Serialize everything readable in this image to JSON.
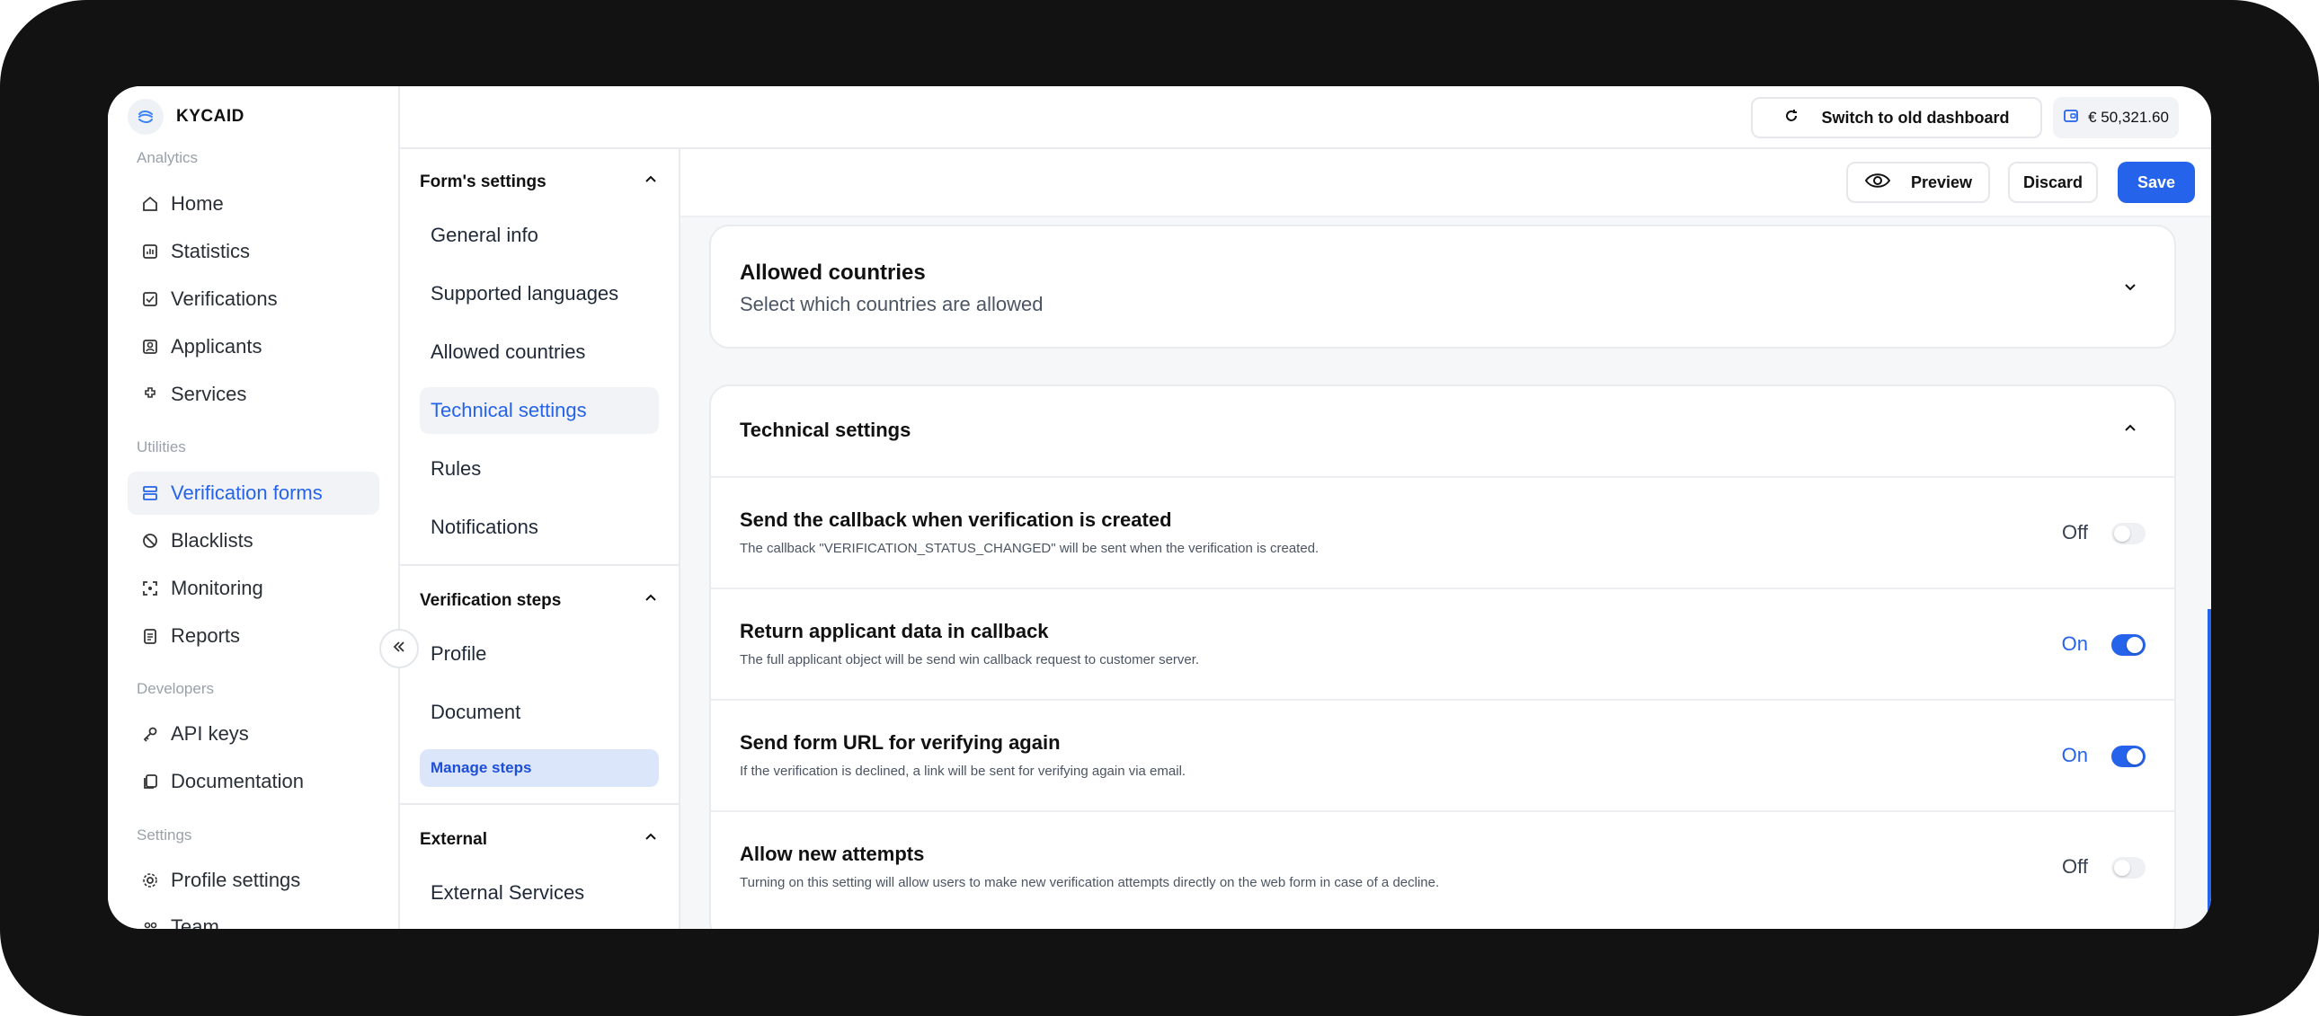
{
  "brand": {
    "name": "KYCAID"
  },
  "sidebar": {
    "sections": [
      {
        "label": "Analytics"
      },
      {
        "label": "Utilities"
      },
      {
        "label": "Developers"
      },
      {
        "label": "Settings"
      }
    ],
    "items": [
      {
        "label": "Home",
        "icon": "home-icon"
      },
      {
        "label": "Statistics",
        "icon": "statistics-icon"
      },
      {
        "label": "Verifications",
        "icon": "verifications-icon"
      },
      {
        "label": "Applicants",
        "icon": "applicants-icon"
      },
      {
        "label": "Services",
        "icon": "services-icon"
      },
      {
        "label": "Verification forms",
        "icon": "forms-icon",
        "active": true
      },
      {
        "label": "Blacklists",
        "icon": "blacklist-icon"
      },
      {
        "label": "Monitoring",
        "icon": "monitoring-icon"
      },
      {
        "label": "Reports",
        "icon": "reports-icon"
      },
      {
        "label": "API keys",
        "icon": "key-icon"
      },
      {
        "label": "Documentation",
        "icon": "documentation-icon"
      },
      {
        "label": "Profile settings",
        "icon": "gear-icon"
      },
      {
        "label": "Team",
        "icon": "team-icon"
      }
    ]
  },
  "topbar": {
    "switch_label": "Switch to old dashboard",
    "balance": "€ 50,321.60"
  },
  "settings_nav": {
    "groups": [
      {
        "title": "Form's settings",
        "items": [
          "General info",
          "Supported languages",
          "Allowed countries",
          "Technical settings",
          "Rules",
          "Notifications"
        ]
      },
      {
        "title": "Verification steps",
        "items": [
          "Profile",
          "Document",
          "Manage steps"
        ]
      },
      {
        "title": "External",
        "items": [
          "External Services"
        ]
      }
    ],
    "active_item": "Technical settings"
  },
  "actions": {
    "preview": "Preview",
    "discard": "Discard",
    "save": "Save"
  },
  "allowed_countries": {
    "title": "Allowed countries",
    "subtitle": "Select which countries are allowed"
  },
  "technical_settings": {
    "title": "Technical settings",
    "rows": [
      {
        "title": "Send the callback when verification is created",
        "desc": "The callback \"VERIFICATION_STATUS_CHANGED\" will be sent when the verification is created.",
        "state": "Off",
        "enabled": false
      },
      {
        "title": "Return applicant data in callback",
        "desc": "The full applicant object will be send win callback request to customer server.",
        "state": "On",
        "enabled": true
      },
      {
        "title": "Send form URL for verifying again",
        "desc": "If the verification is declined, a link will be sent for verifying again via email.",
        "state": "On",
        "enabled": true
      },
      {
        "title": "Allow new attempts",
        "desc": "Turning on this setting will allow users to make new verification attempts directly on the web form in case of a decline.",
        "state": "Off",
        "enabled": false
      }
    ]
  },
  "colors": {
    "accent": "#2563eb",
    "frame": "#121212",
    "content_bg": "#f6f7f9"
  }
}
